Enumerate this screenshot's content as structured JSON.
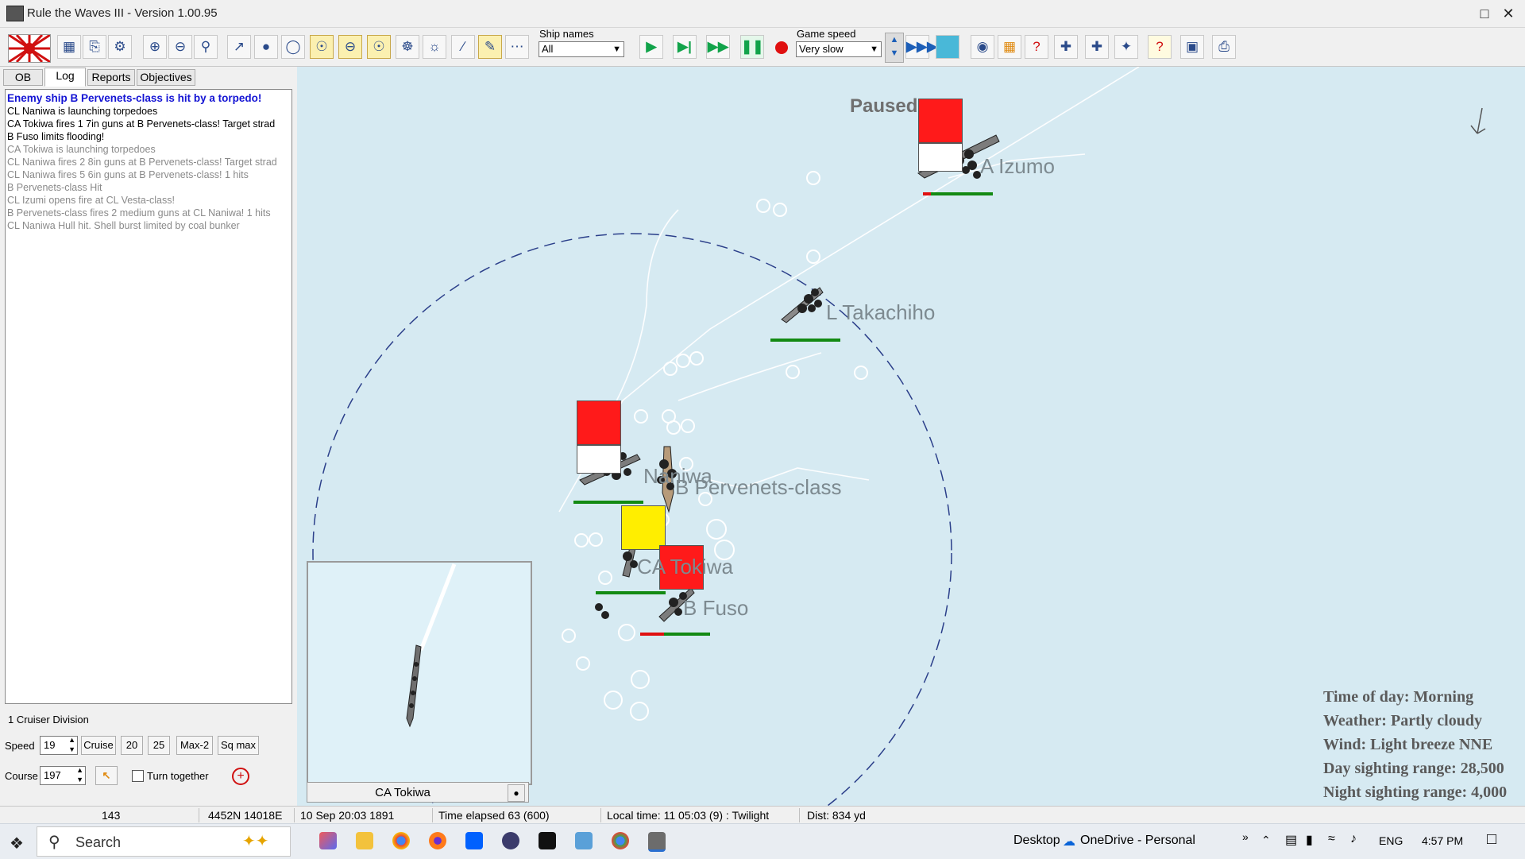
{
  "window": {
    "title": "Rule the Waves III - Version 1.00.95"
  },
  "toolbar": {
    "ship_names_label": "Ship names",
    "ship_names_value": "All",
    "game_speed_label": "Game speed",
    "game_speed_value": "Very slow"
  },
  "tabs": [
    "OB",
    "Log",
    "Reports",
    "Objectives"
  ],
  "log": {
    "lines": [
      "Enemy ship B Pervenets-class is hit by a torpedo!",
      "CL Naniwa is launching torpedoes",
      "CA Tokiwa fires 1 7in guns at B Pervenets-class! Target strad",
      "B Fuso limits flooding!",
      "CA Tokiwa is launching torpedoes",
      "CL Naniwa fires 2 8in guns at B Pervenets-class! Target strad",
      "CL Naniwa fires 5 6in guns at B Pervenets-class! 1 hits",
      "B Pervenets-class Hit",
      "CL Izumi opens fire at CL Vesta-class!",
      "B Pervenets-class fires 2 medium guns at CL Naniwa! 1 hits",
      "CL Naniwa Hull hit. Shell burst limited by coal bunker"
    ]
  },
  "division": {
    "name": "1 Cruiser Division",
    "speed_label": "Speed",
    "speed_value": "19",
    "cruise_label": "Cruise",
    "btn_20": "20",
    "btn_25": "25",
    "max2_label": "Max-2",
    "sqmax_label": "Sq max",
    "course_label": "Course",
    "course_value": "197",
    "turn_together_label": "Turn together"
  },
  "map": {
    "paused_label": "Paused",
    "ships": {
      "izumo": "A Izumo",
      "takachiho": "L Takachiho",
      "naniwa": "Naniwa",
      "pervenets": "B Pervenets-class",
      "tokiwa": "CA Tokiwa",
      "fuso": "B Fuso"
    },
    "minimap_caption": "CA Tokiwa"
  },
  "weather": {
    "time_of_day": "Time of day: Morning",
    "weather": "Weather: Partly cloudy",
    "wind": "Wind: Light breeze  NNE",
    "day_sighting": "Day sighting range: 28,500",
    "night_sighting": "Night sighting range: 4,000"
  },
  "statusbar": {
    "cell1": "143",
    "coords": "4452N 14018E",
    "date": "10 Sep 20:03 1891",
    "elapsed": "Time elapsed 63 (600)",
    "local_time": "Local time: 11 05:03 (9) : Twilight",
    "dist": "Dist: 834 yd"
  },
  "taskbar": {
    "search_placeholder": "Search",
    "desktop_label": "Desktop",
    "onedrive_label": "OneDrive - Personal",
    "lang": "ENG",
    "clock": "4:57 PM"
  },
  "colors": {
    "sea": "#d6eaf2",
    "flag_red": "#ff1a1a",
    "flag_yellow": "#ffee00",
    "hp_green": "#138a13",
    "log_highlight": "#1414d4"
  }
}
